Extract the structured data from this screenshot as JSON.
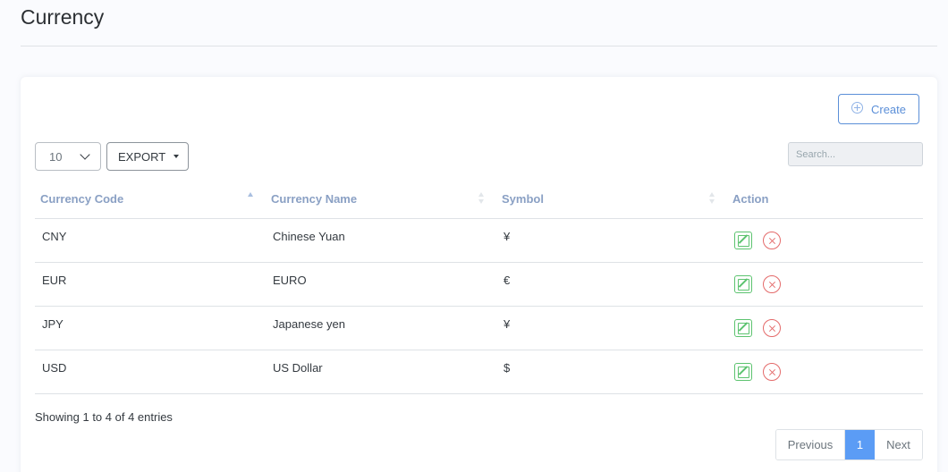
{
  "page": {
    "title": "Currency"
  },
  "toolbar": {
    "create_label": "Create",
    "page_length": "10",
    "export_label": "EXPORT",
    "search_placeholder": "Search..."
  },
  "table": {
    "columns": [
      "Currency Code",
      "Currency Name",
      "Symbol",
      "Action"
    ],
    "rows": [
      {
        "code": "CNY",
        "name": "Chinese Yuan",
        "symbol": "¥"
      },
      {
        "code": "EUR",
        "name": "EURO",
        "symbol": "€"
      },
      {
        "code": "JPY",
        "name": "Japanese yen",
        "symbol": "¥"
      },
      {
        "code": "USD",
        "name": "US Dollar",
        "symbol": "$"
      }
    ]
  },
  "footer": {
    "info": "Showing 1 to 4 of 4 entries",
    "prev_label": "Previous",
    "current_page": "1",
    "next_label": "Next"
  },
  "colors": {
    "primary": "#5b9cf5",
    "edit": "#5cc36f",
    "delete": "#e46a6a",
    "header_text": "#8aa0c4"
  },
  "icons": [
    "plus-circle-icon",
    "chevron-down-icon",
    "caret-down-icon",
    "sort-icon",
    "edit-icon",
    "delete-icon"
  ]
}
